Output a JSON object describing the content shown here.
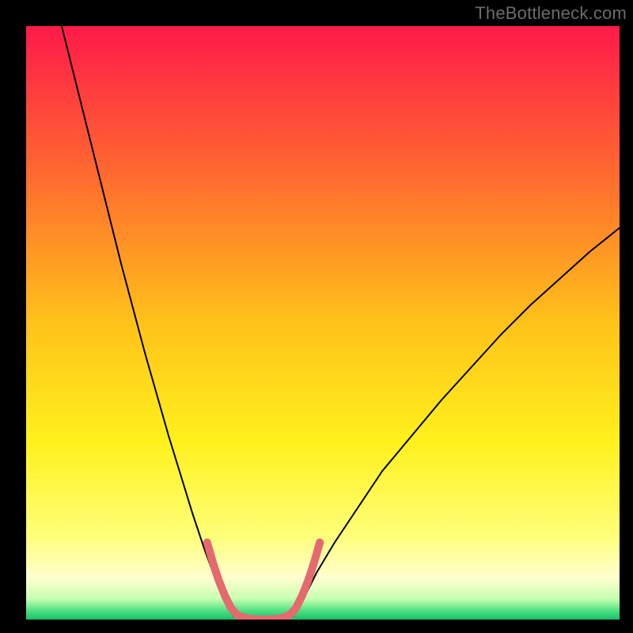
{
  "watermark": "TheBottleneck.com",
  "chart_data": {
    "type": "line",
    "title": "",
    "xlabel": "",
    "ylabel": "",
    "xlim": [
      0,
      100
    ],
    "ylim": [
      0,
      100
    ],
    "grid": false,
    "background_gradient": {
      "direction": "vertical",
      "stops": [
        {
          "pos": 0.0,
          "color": "#ff1a4a"
        },
        {
          "pos": 0.25,
          "color": "#ff6a2f"
        },
        {
          "pos": 0.5,
          "color": "#ffc21a"
        },
        {
          "pos": 0.7,
          "color": "#fff11c"
        },
        {
          "pos": 0.86,
          "color": "#ffff7a"
        },
        {
          "pos": 0.93,
          "color": "#ffffd0"
        },
        {
          "pos": 0.965,
          "color": "#c7ffb0"
        },
        {
          "pos": 0.985,
          "color": "#4fe083"
        },
        {
          "pos": 1.0,
          "color": "#18c06a"
        }
      ]
    },
    "series": [
      {
        "name": "bottleneck-curve-left",
        "color": "#000000",
        "stroke_width": 2,
        "x": [
          6,
          8,
          10,
          12,
          14,
          16,
          18,
          20,
          22,
          24,
          26,
          28,
          30,
          32,
          33.5,
          35
        ],
        "y": [
          100,
          92,
          84,
          76,
          68,
          60,
          52.5,
          45,
          38,
          31,
          24.5,
          18,
          12,
          6.5,
          3,
          0.5
        ]
      },
      {
        "name": "bottleneck-curve-right",
        "color": "#000000",
        "stroke_width": 2,
        "x": [
          45,
          46.5,
          49,
          52,
          56,
          60,
          65,
          70,
          75,
          80,
          85,
          90,
          95,
          100
        ],
        "y": [
          0.5,
          3,
          8,
          13,
          19,
          25,
          31,
          37,
          42.5,
          48,
          53,
          57.5,
          62,
          66
        ]
      },
      {
        "name": "highlight-left-segment",
        "color": "#e46a6f",
        "stroke_width": 10,
        "x": [
          30.5,
          31.5,
          32.5,
          33.5,
          34.5,
          35.5
        ],
        "y": [
          13,
          9.5,
          6.5,
          4,
          2,
          0.8
        ]
      },
      {
        "name": "highlight-bottom-segment",
        "color": "#e46a6f",
        "stroke_width": 10,
        "x": [
          35.5,
          37,
          39,
          41,
          43,
          44.5
        ],
        "y": [
          0.8,
          0.2,
          0,
          0,
          0.2,
          0.8
        ]
      },
      {
        "name": "highlight-right-segment",
        "color": "#e46a6f",
        "stroke_width": 10,
        "x": [
          44.5,
          45.5,
          46.5,
          47.5,
          48.5,
          49.5
        ],
        "y": [
          0.8,
          2,
          4,
          6.5,
          9.5,
          13
        ]
      }
    ]
  }
}
